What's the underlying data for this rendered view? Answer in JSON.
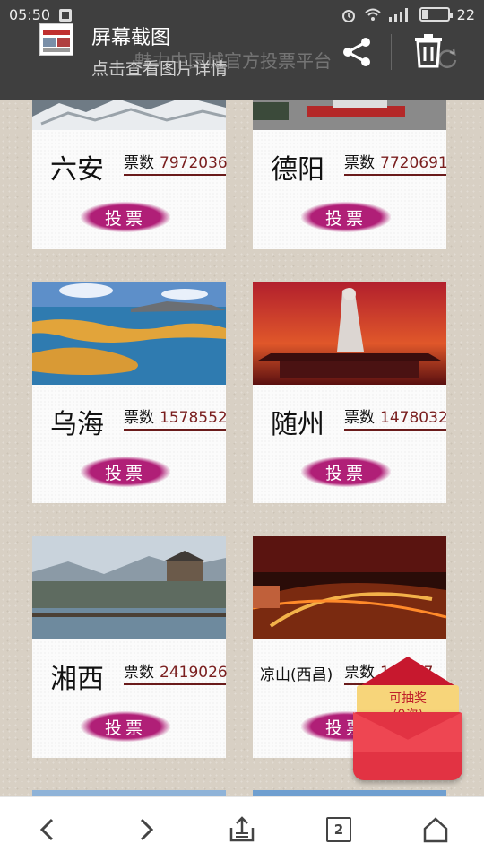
{
  "status_bar": {
    "time": "05:50",
    "battery": "22"
  },
  "notification": {
    "title": "屏幕截图",
    "subtitle": "点击查看图片详情",
    "background_page_title": "魅力中国城官方投票平台"
  },
  "vote_label_prefix": "票数",
  "vote_button_label": "投票",
  "cities": [
    {
      "name": "六安",
      "votes": "7972036",
      "image": "snow-mountain-photo"
    },
    {
      "name": "德阳",
      "votes": "7720691",
      "image": "park-plaza-photo"
    },
    {
      "name": "乌海",
      "votes": "1578552",
      "image": "lake-sand-islands-photo"
    },
    {
      "name": "随州",
      "votes": "1478032",
      "image": "statue-sunset-photo"
    },
    {
      "name": "湘西",
      "votes": "2419026",
      "image": "riverside-town-photo"
    },
    {
      "name": "凉山(西昌)",
      "votes": "10 517",
      "image": "torch-festival-photo"
    }
  ],
  "red_packet": {
    "label": "可抽奖",
    "count": "(0次)"
  },
  "bottom_nav": {
    "tab_count": "2",
    "icons": [
      "chevron-left-icon",
      "chevron-right-icon",
      "share-tray-icon",
      "tabs-icon",
      "home-icon"
    ]
  },
  "colors": {
    "vote_button": "#b01f77",
    "vote_underline": "#6a1b1b",
    "notification_bg": "#3f3f3f",
    "page_bg": "#d8d0c4",
    "red_packet": "#e23343"
  }
}
